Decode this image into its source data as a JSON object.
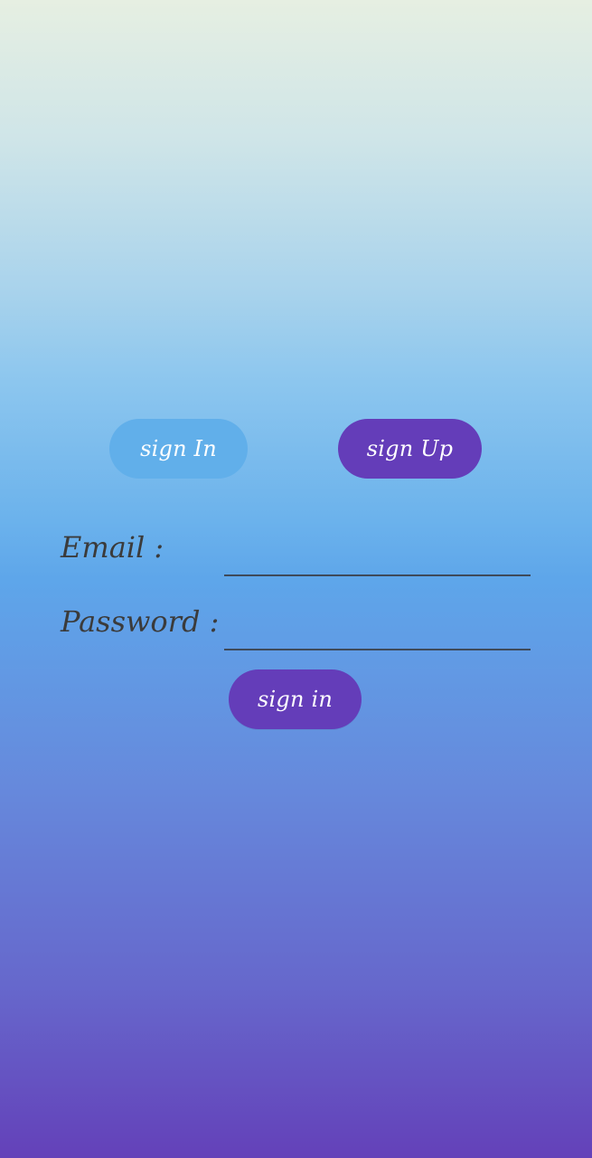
{
  "auth_tabs": {
    "sign_in_label": "sign In",
    "sign_up_label": "sign Up"
  },
  "form": {
    "email_label": "Email :",
    "email_value": "",
    "password_label": "Password :",
    "password_value": "",
    "submit_label": "sign in"
  },
  "colors": {
    "accent_purple": "#643db9",
    "tab_inactive_blue": "#61afea",
    "label_text": "#3b3b3b",
    "input_underline": "#3e4a5a",
    "gradient_top": "#e6efe2",
    "gradient_bottom": "#6441b9"
  }
}
